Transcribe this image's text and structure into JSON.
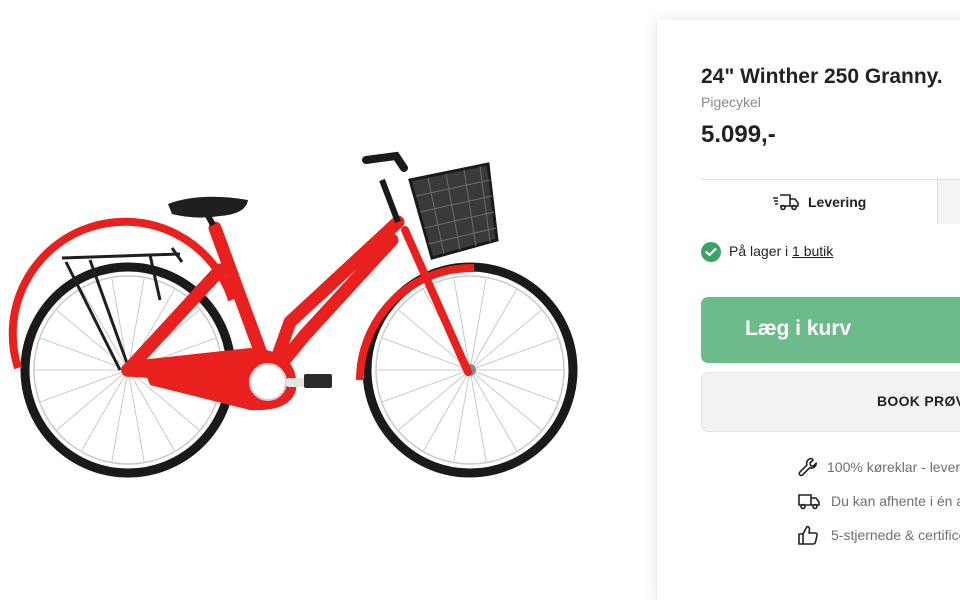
{
  "product": {
    "title": "24\" Winther 250 Granny.",
    "category": "Pigecykel",
    "price": "5.099,-",
    "image_alt": "Rød pigecykel med kurv",
    "frame_color": "#e8211f"
  },
  "delivery_tabs": {
    "active_label": "Levering",
    "icon": "truck-icon"
  },
  "stock": {
    "prefix": "På lager i ",
    "link_text": "1 butik",
    "status_color": "#3da265"
  },
  "buttons": {
    "add_to_cart": "Læg i kurv",
    "add_to_cart_color": "#6dbb8a",
    "book_test": "BOOK PRØV"
  },
  "usps": [
    {
      "icon": "wrench-icon",
      "text": "100% køreklar - lever"
    },
    {
      "icon": "truck-icon",
      "text": "Du kan afhente i én a"
    },
    {
      "icon": "thumbs-up-icon",
      "text": "5-stjernede & certifice"
    }
  ]
}
